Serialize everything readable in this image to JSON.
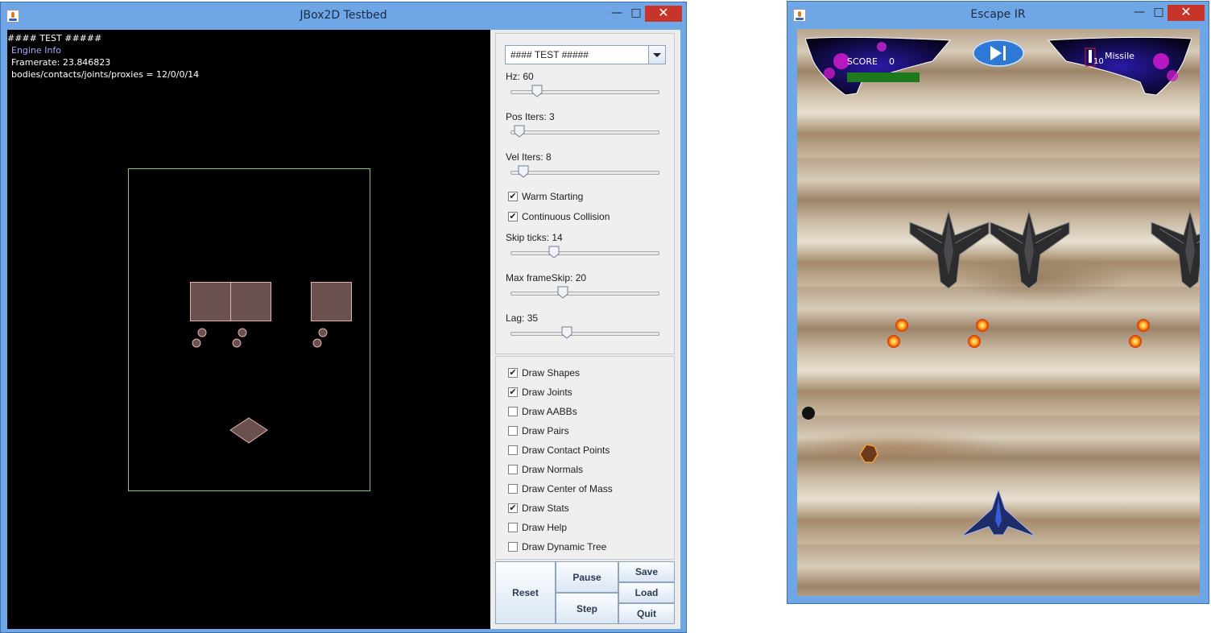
{
  "jbox": {
    "title": "JBox2D Testbed",
    "minimize_glyph": "—",
    "maximize_glyph": "□",
    "close_glyph": "✕",
    "stats": {
      "test_name": "#### TEST #####",
      "engine_info": "Engine Info",
      "framerate": "Framerate: 23.846823",
      "counts": "bodies/contacts/joints/proxies = 12/0/0/14"
    },
    "test_select": {
      "value": "#### TEST #####"
    },
    "sliders": [
      {
        "label": "Hz: 60",
        "value": 60,
        "level": 0.15
      },
      {
        "label": "Pos Iters: 3",
        "value": 3,
        "level": 0.02
      },
      {
        "label": "Vel Iters: 8",
        "value": 8,
        "level": 0.05
      },
      {
        "label": "Skip ticks: 14",
        "value": 14,
        "level": 0.27
      },
      {
        "label": "Max frameSkip: 20",
        "value": 20,
        "level": 0.33
      },
      {
        "label": "Lag: 35",
        "value": 35,
        "level": 0.36
      }
    ],
    "sim_checks": [
      {
        "label": "Warm Starting",
        "checked": true
      },
      {
        "label": "Continuous Collision",
        "checked": true
      }
    ],
    "draw_checks": [
      {
        "label": "Draw Shapes",
        "checked": true
      },
      {
        "label": "Draw Joints",
        "checked": true
      },
      {
        "label": "Draw AABBs",
        "checked": false
      },
      {
        "label": "Draw Pairs",
        "checked": false
      },
      {
        "label": "Draw Contact Points",
        "checked": false
      },
      {
        "label": "Draw Normals",
        "checked": false
      },
      {
        "label": "Draw Center of Mass",
        "checked": false
      },
      {
        "label": "Draw Stats",
        "checked": true
      },
      {
        "label": "Draw Help",
        "checked": false
      },
      {
        "label": "Draw Dynamic Tree",
        "checked": false
      }
    ],
    "buttons": {
      "reset": "Reset",
      "pause": "Pause",
      "step": "Step",
      "save": "Save",
      "load": "Load",
      "quit": "Quit"
    },
    "colors": {
      "boundary": "#7ec87e",
      "body_fill": "#6b5050",
      "body_stroke": "#e8b0b0"
    }
  },
  "escape": {
    "title": "Escape IR",
    "hud": {
      "score_label": "SCORE",
      "score_value": "0",
      "missile_label": "Missile",
      "missile_count": "10",
      "health": 1.0
    },
    "colors": {
      "health": "#1c7a1c"
    },
    "icons": [
      "play-skip-icon"
    ]
  }
}
